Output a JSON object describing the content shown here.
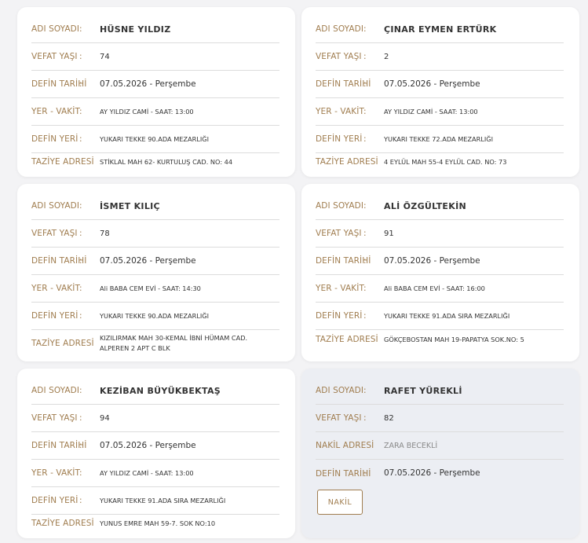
{
  "labels": {
    "name": "ADI SOYADI",
    "age": "VEFAT YAŞI",
    "burial_date": "DEFİN TARİHİ",
    "place_time": "YER - VAKİT",
    "burial_place": "DEFİN YERİ",
    "condolence_address": "TAZİYE ADRESİ",
    "transfer_address": "NAKİL ADRESİ",
    "colon": ":"
  },
  "cards": [
    {
      "name": "HÜSNE YILDIZ",
      "age": "74",
      "burial_date": "07.05.2026 - Perşembe",
      "place_time": "AY YILDIZ CAMİ - SAAT: 13:00",
      "burial_place": "YUKARI TEKKE 90.ADA MEZARLIĞI",
      "condolence_address": "STİKLAL MAH 62- KURTULUŞ CAD. NO: 44"
    },
    {
      "name": "ÇINAR EYMEN ERTÜRK",
      "age": "2",
      "burial_date": "07.05.2026 - Perşembe",
      "place_time": "AY YILDIZ CAMİ - SAAT: 13:00",
      "burial_place": "YUKARI TEKKE 72.ADA MEZARLIĞI",
      "condolence_address": "4 EYLÜL MAH 55-4 EYLÜL CAD. NO: 73"
    },
    {
      "name": "İSMET KILIÇ",
      "age": "78",
      "burial_date": "07.05.2026 - Perşembe",
      "place_time": "Ali BABA CEM EVİ - SAAT: 14:30",
      "burial_place": "YUKARI TEKKE 90.ADA MEZARLIĞI",
      "condolence_address": "KIZILIRMAK MAH 30-KEMAL İBNİ HÜMAM CAD. ALPEREN 2 APT C BLK"
    },
    {
      "name": "ALİ ÖZGÜLTEKİN",
      "age": "91",
      "burial_date": "07.05.2026 - Perşembe",
      "place_time": "Ali BABA CEM EVİ - SAAT: 16:00",
      "burial_place": "YUKARI TEKKE 91.ADA SIRA MEZARLIĞI",
      "condolence_address": "GÖKÇEBOSTAN MAH 19-PAPATYA SOK.NO: 5"
    },
    {
      "name": "KEZİBAN BÜYÜKBEKTAŞ",
      "age": "94",
      "burial_date": "07.05.2026 - Perşembe",
      "place_time": "AY YILDIZ CAMİ - SAAT: 13:00",
      "burial_place": "YUKARI TEKKE 91.ADA SIRA MEZARLIĞI",
      "condolence_address": "YUNUS EMRE MAH 59-7. SOK NO:10"
    }
  ],
  "transfer_card": {
    "name": "RAFET YÜREKLİ",
    "age": "82",
    "transfer_address": "ZARA BECEKLİ",
    "burial_date": "07.05.2026 - Perşembe",
    "button_label": "NAKİL"
  }
}
